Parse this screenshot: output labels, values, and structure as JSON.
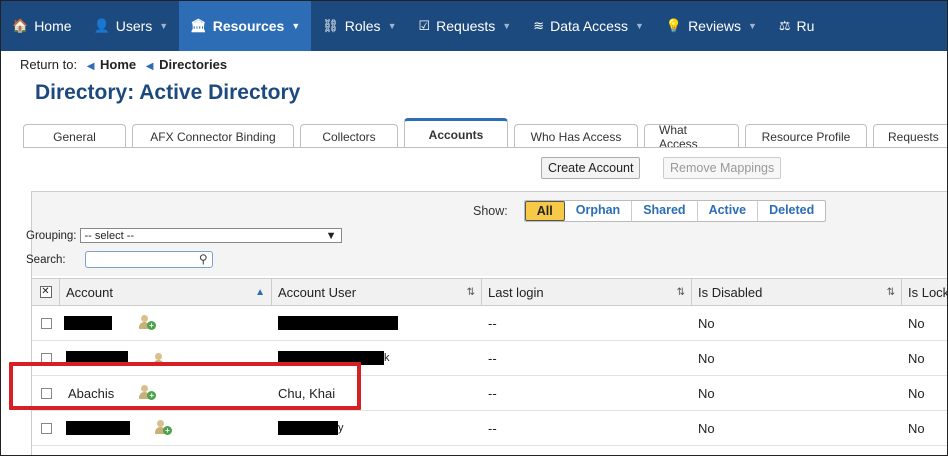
{
  "nav": {
    "items": [
      {
        "label": "Home",
        "icon": "home-icon",
        "glyph": "🏠",
        "caret": ""
      },
      {
        "label": "Users",
        "icon": "users-icon",
        "glyph": "👤",
        "caret": "▼"
      },
      {
        "label": "Resources",
        "icon": "bank-icon",
        "glyph": "🏛",
        "caret": "▼"
      },
      {
        "label": "Roles",
        "icon": "sitemap-icon",
        "glyph": "⛓",
        "caret": "▼"
      },
      {
        "label": "Requests",
        "icon": "check-square-icon",
        "glyph": "☑",
        "caret": "▼"
      },
      {
        "label": "Data Access",
        "icon": "database-icon",
        "glyph": "≋",
        "caret": "▼"
      },
      {
        "label": "Reviews",
        "icon": "bulb-icon",
        "glyph": "💡",
        "caret": "▼"
      },
      {
        "label": "Ru",
        "icon": "balance-icon",
        "glyph": "⚖",
        "caret": ""
      }
    ],
    "active_index": 2,
    "bg_color": "#1d4a7e",
    "active_color": "#2c6db5"
  },
  "breadcrumb": {
    "prefix": "Return to:",
    "arrow": "◀",
    "items": [
      "Home",
      "Directories"
    ]
  },
  "page": {
    "title": "Directory: Active Directory",
    "title_color": "#1d4a7e"
  },
  "tabs": [
    {
      "label": "General"
    },
    {
      "label": "AFX Connector Binding"
    },
    {
      "label": "Collectors"
    },
    {
      "label": "Accounts"
    },
    {
      "label": "Who Has Access"
    },
    {
      "label": "What Access"
    },
    {
      "label": "Resource Profile"
    },
    {
      "label": "Requests"
    }
  ],
  "active_tab_index": 3,
  "actions": {
    "create_account": "Create Account",
    "remove_mappings": "Remove Mappings"
  },
  "filters": {
    "show_label": "Show:",
    "options": [
      "All",
      "Orphan",
      "Shared",
      "Active",
      "Deleted"
    ],
    "selected": "All",
    "grouping_label": "Grouping:",
    "grouping_value": "-- select --",
    "search_label": "Search:",
    "search_value": ""
  },
  "table": {
    "columns": [
      "Account",
      "Account User",
      "Last login",
      "Is Disabled",
      "Is Lock"
    ],
    "rows": [
      {
        "account": "",
        "account_redacted": true,
        "user": "",
        "user_redacted": true,
        "last_login": "--",
        "is_disabled": "No",
        "is_locked": "No"
      },
      {
        "account": "",
        "account_redacted": true,
        "user": "",
        "user_redacted": true,
        "user_suffix": "k",
        "last_login": "--",
        "is_disabled": "No",
        "is_locked": "No"
      },
      {
        "account": "Abachis",
        "account_redacted": false,
        "user": "Chu, Khai",
        "user_redacted": false,
        "last_login": "--",
        "is_disabled": "No",
        "is_locked": "No"
      },
      {
        "account": "",
        "account_redacted": true,
        "user": "",
        "user_redacted": true,
        "user_suffix": "y",
        "last_login": "--",
        "is_disabled": "No",
        "is_locked": "No"
      }
    ]
  },
  "highlight_color": "#d71f26"
}
